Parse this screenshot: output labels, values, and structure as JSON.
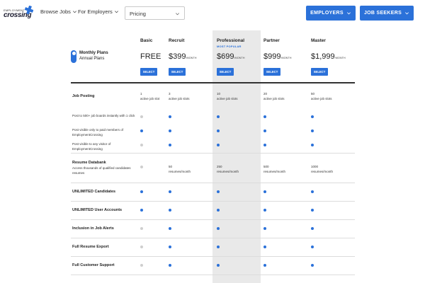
{
  "header": {
    "logo_small": "EMPLOYMENT",
    "logo_big": "crossing",
    "nav": [
      {
        "label": "Browse Jobs"
      },
      {
        "label": "For Employers"
      }
    ],
    "pricing_select": {
      "value": "Pricing"
    },
    "buttons": {
      "employers": "EMPLOYERS",
      "job_seekers": "JOB SEEKERS"
    }
  },
  "toggle": {
    "monthly": "Monthly Plans",
    "annual": "Annual Plans"
  },
  "plans": [
    {
      "name": "Basic",
      "price": "FREE",
      "per": "",
      "select": "SELECT"
    },
    {
      "name": "Recruit",
      "price": "$399",
      "per": "/MONTH",
      "select": "SELECT"
    },
    {
      "name": "Professional",
      "price": "$699",
      "per": "/MONTH",
      "select": "SELECT",
      "badge": "MOST POPULAR"
    },
    {
      "name": "Partner",
      "price": "$999",
      "per": "/MONTH",
      "select": "SELECT"
    },
    {
      "name": "Master",
      "price": "$1,999",
      "per": "/MONTH",
      "select": "SELECT"
    }
  ],
  "features": {
    "job_posting": {
      "label": "Job Posting",
      "values": [
        {
          "num": "1",
          "unit": "active job slot"
        },
        {
          "num": "3",
          "unit": "active job slots"
        },
        {
          "num": "10",
          "unit": "active job slots"
        },
        {
          "num": "20",
          "unit": "active job slots"
        },
        {
          "num": "50",
          "unit": "active job slots"
        }
      ],
      "subs": [
        {
          "text": "Post to 500+ job boards instantly with 1 click",
          "dots": [
            false,
            true,
            true,
            true,
            true
          ]
        },
        {
          "text": "Post visible only to paid members of EmploymentCrossing",
          "dots": [
            true,
            true,
            true,
            true,
            true
          ]
        },
        {
          "text": "Post visible to any visitor of EmploymentCrossing",
          "dots": [
            false,
            true,
            true,
            true,
            true
          ]
        }
      ]
    },
    "resume_databank": {
      "label": "Resume Databank",
      "sub": "Access thousands of qualified candidates resumes",
      "values": [
        {
          "num": "",
          "unit": ""
        },
        {
          "num": "50",
          "unit": "resumes/month"
        },
        {
          "num": "250",
          "unit": "resumes/month"
        },
        {
          "num": "500",
          "unit": "resumes/month"
        },
        {
          "num": "1000",
          "unit": "resumes/month"
        }
      ]
    },
    "simple": [
      {
        "label": "UNLIMITED Candidates",
        "dots": [
          true,
          true,
          true,
          true,
          true
        ]
      },
      {
        "label": "UNLIMITED User Accounts",
        "dots": [
          true,
          true,
          true,
          true,
          true
        ]
      },
      {
        "label": "Inclusion in Job Alerts",
        "dots": [
          false,
          true,
          true,
          true,
          true
        ]
      },
      {
        "label": "Full Resume Export",
        "dots": [
          false,
          true,
          true,
          true,
          true
        ]
      },
      {
        "label": "Full Customer Support",
        "dots": [
          false,
          true,
          true,
          true,
          true
        ]
      }
    ]
  },
  "colors": {
    "accent": "#2b71d9",
    "highlight_column": "#e9e9e9",
    "dot_off": "#cfcfcf"
  }
}
